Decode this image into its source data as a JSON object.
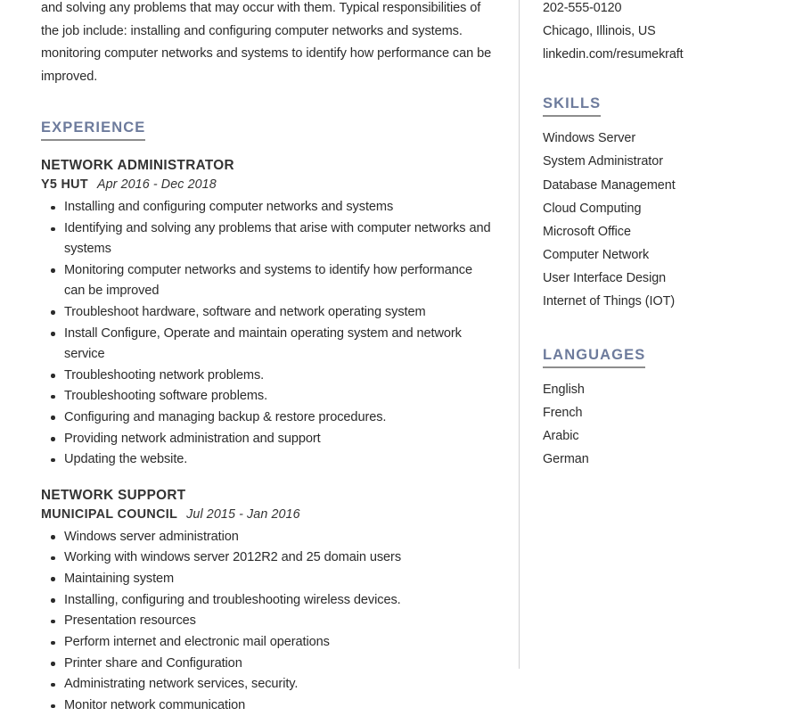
{
  "document": {
    "type": "resume",
    "accent_color": "#6d7b9c",
    "text_color": "#2b2b2b",
    "rule_color": "#8d8d8d",
    "divider_color": "#d2d2d4"
  },
  "main": {
    "summary": "and solving any problems that may occur with them. Typical responsibilities of the job include: installing and configuring computer networks and systems. monitoring computer networks and systems to identify how performance can be improved.",
    "experience": {
      "heading": "EXPERIENCE",
      "jobs": [
        {
          "title": "NETWORK ADMINISTRATOR",
          "company": "Y5 HUT",
          "dates": "Apr 2016 - Dec 2018",
          "bullets": [
            "Installing and configuring computer networks and systems",
            "Identifying and solving any problems that arise with computer networks and systems",
            "Monitoring computer networks and systems to identify how performance can be improved",
            "Troubleshoot hardware, software and network operating system",
            "Install Configure, Operate and maintain operating system and network service",
            "Troubleshooting network problems.",
            "Troubleshooting software problems.",
            "Configuring and managing backup & restore procedures.",
            "Providing network administration and support",
            "Updating the website."
          ]
        },
        {
          "title": "NETWORK SUPPORT",
          "company": "MUNICIPAL COUNCIL",
          "dates": "Jul 2015 - Jan 2016",
          "bullets": [
            "Windows server administration",
            "Working with windows server 2012R2 and 25 domain users",
            "Maintaining system",
            "Installing, configuring and troubleshooting wireless devices.",
            "Presentation resources",
            "Perform internet and electronic mail operations",
            "Printer share and Configuration",
            "Administrating network services, security.",
            "Monitor network communication"
          ]
        }
      ]
    }
  },
  "sidebar": {
    "contact": [
      "202-555-0120",
      "Chicago, Illinois, US",
      "linkedin.com/resumekraft"
    ],
    "skills": {
      "heading": "SKILLS",
      "items": [
        "Windows Server",
        "System Administrator",
        "Database Management",
        "Cloud Computing",
        "Microsoft Office",
        "Computer Network",
        "User Interface Design",
        "Internet of Things (IOT)"
      ]
    },
    "languages": {
      "heading": "LANGUAGES",
      "items": [
        "English",
        "French",
        "Arabic",
        "German"
      ]
    }
  }
}
